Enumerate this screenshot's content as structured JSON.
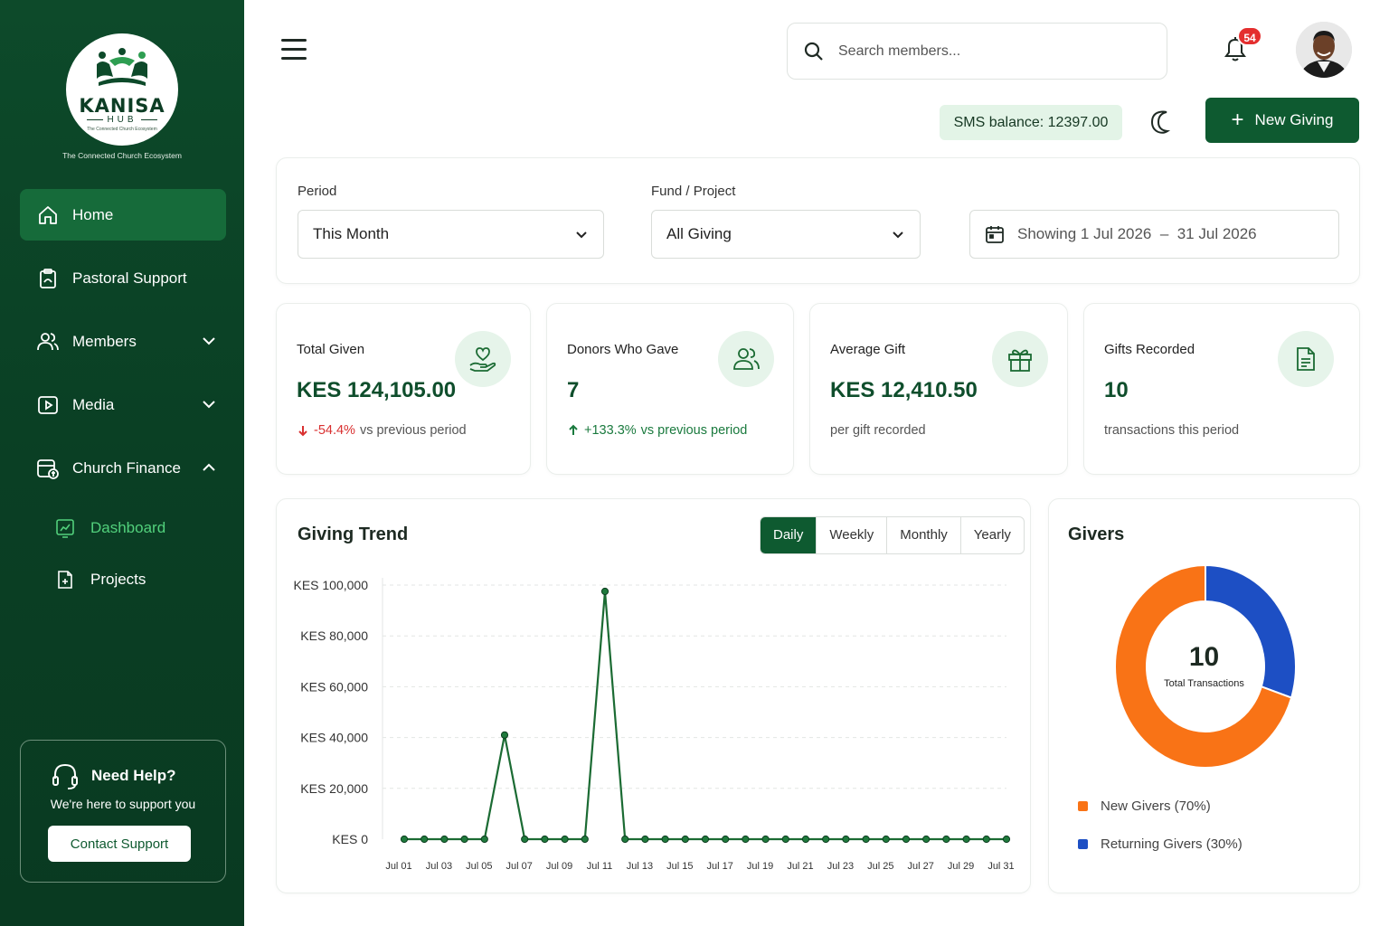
{
  "brand": {
    "name": "KANISA",
    "sub": "HUB",
    "small_tag": "The Connected Church Ecosystem",
    "tagline": "The Connected Church Ecosystem"
  },
  "sidebar": {
    "items": [
      {
        "label": "Home",
        "icon": "home-icon"
      },
      {
        "label": "Pastoral Support",
        "icon": "clipboard-icon"
      },
      {
        "label": "Members",
        "icon": "users-icon"
      },
      {
        "label": "Media",
        "icon": "play-icon"
      },
      {
        "label": "Church Finance",
        "icon": "finance-icon"
      }
    ],
    "sub_items": [
      {
        "label": "Dashboard",
        "icon": "dashboard-icon"
      },
      {
        "label": "Projects",
        "icon": "file-plus-icon"
      }
    ],
    "help": {
      "title": "Need Help?",
      "subtitle": "We're here to support you",
      "button": "Contact Support"
    }
  },
  "header": {
    "search_placeholder": "Search members...",
    "notification_count": "54",
    "sms_balance": "SMS balance: 12397.00",
    "new_button": "New Giving"
  },
  "filters": {
    "period_label": "Period",
    "period_value": "This Month",
    "fund_label": "Fund / Project",
    "fund_value": "All Giving",
    "date_text": "Showing 1 Jul 2026  –  31 Jul 2026"
  },
  "stats": [
    {
      "label": "Total Given",
      "value": "KES 124,105.00",
      "change": "-54.4%",
      "change_suffix": "vs previous period",
      "direction": "down",
      "icon": "heart-hand-icon"
    },
    {
      "label": "Donors Who Gave",
      "value": "7",
      "change": "+133.3%",
      "change_suffix": "vs previous period",
      "direction": "up",
      "icon": "users-icon"
    },
    {
      "label": "Average Gift",
      "value": "KES 12,410.50",
      "sub": "per gift recorded",
      "icon": "gift-icon"
    },
    {
      "label": "Gifts Recorded",
      "value": "10",
      "sub": "transactions this period",
      "icon": "document-icon"
    }
  ],
  "trend": {
    "title": "Giving Trend",
    "tabs": [
      "Daily",
      "Weekly",
      "Monthly",
      "Yearly"
    ],
    "active_tab": "Daily"
  },
  "givers": {
    "title": "Givers",
    "total": "10",
    "total_label": "Total Transactions",
    "legend": [
      {
        "label": "New Givers (70%)",
        "color": "#f97316"
      },
      {
        "label": "Returning Givers (30%)",
        "color": "#1d4fc4"
      }
    ]
  },
  "chart_data": [
    {
      "type": "line",
      "title": "Giving Trend",
      "y_tick_labels": [
        "KES 100,000",
        "KES 80,000",
        "KES 60,000",
        "KES 40,000",
        "KES 20,000",
        "KES 0"
      ],
      "x_tick_labels": [
        "Jul 01",
        "Jul 03",
        "Jul 05",
        "Jul 07",
        "Jul 09",
        "Jul 11",
        "Jul 13",
        "Jul 15",
        "Jul 17",
        "Jul 19",
        "Jul 21",
        "Jul 23",
        "Jul 25",
        "Jul 27",
        "Jul 29",
        "Jul 31"
      ],
      "ylim": [
        0,
        100000
      ],
      "x": [
        "Jul 01",
        "Jul 02",
        "Jul 03",
        "Jul 04",
        "Jul 05",
        "Jul 06",
        "Jul 07",
        "Jul 08",
        "Jul 09",
        "Jul 10",
        "Jul 11",
        "Jul 12",
        "Jul 13",
        "Jul 14",
        "Jul 15",
        "Jul 16",
        "Jul 17",
        "Jul 18",
        "Jul 19",
        "Jul 20",
        "Jul 21",
        "Jul 22",
        "Jul 23",
        "Jul 24",
        "Jul 25",
        "Jul 26",
        "Jul 27",
        "Jul 28",
        "Jul 29",
        "Jul 30",
        "Jul 31"
      ],
      "series": [
        {
          "values": [
            0,
            0,
            0,
            0,
            0,
            41000,
            0,
            0,
            0,
            0,
            97500,
            0,
            0,
            0,
            0,
            0,
            0,
            0,
            0,
            0,
            0,
            0,
            0,
            0,
            0,
            0,
            0,
            0,
            0,
            0,
            0
          ],
          "color": "#1b6b33"
        }
      ],
      "grid": true
    },
    {
      "type": "pie",
      "title": "Givers",
      "categories": [
        "New Givers",
        "Returning Givers"
      ],
      "values": [
        70,
        30
      ],
      "colors": [
        "#f97316",
        "#1d4fc4"
      ],
      "center_value": "10",
      "center_label": "Total Transactions"
    }
  ]
}
